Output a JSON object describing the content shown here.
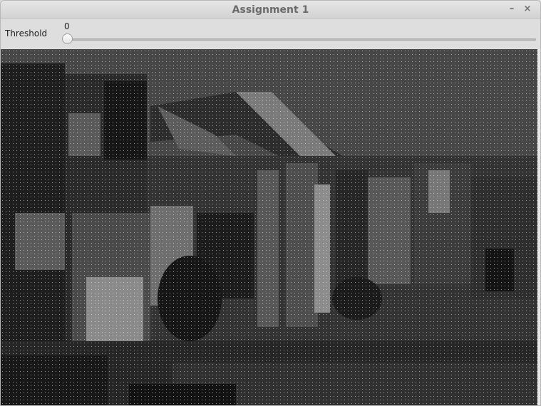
{
  "window": {
    "title": "Assignment 1",
    "minimize_glyph": "–",
    "close_glyph": "×"
  },
  "toolbar": {
    "threshold_label": "Threshold",
    "slider_value": "0",
    "slider_level": 0
  },
  "image": {
    "description_icon": "dotted-grayscale-building-image"
  }
}
